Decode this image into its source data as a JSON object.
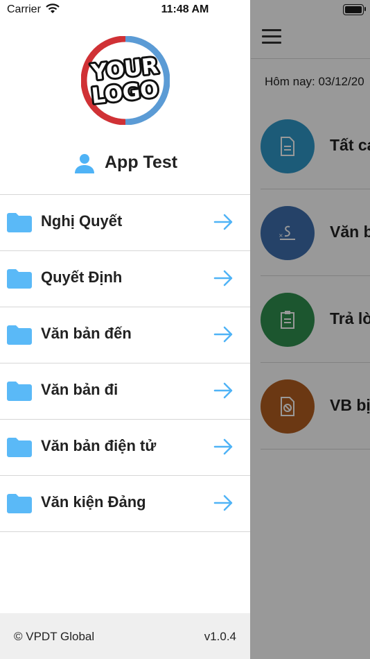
{
  "status_bar": {
    "carrier": "Carrier",
    "time": "11:48 AM"
  },
  "main": {
    "today": "Hôm nay: 03/12/20",
    "items": [
      {
        "label": "Tất ca",
        "color": "#2f98c9",
        "icon": "document-icon"
      },
      {
        "label": "Văn b",
        "color": "#3f6fae",
        "icon": "signature-icon"
      },
      {
        "label": "Trả lờ",
        "color": "#2f8f4f",
        "icon": "clipboard-icon"
      },
      {
        "label": "VB bị",
        "color": "#b25e21",
        "icon": "blocked-document-icon"
      }
    ]
  },
  "drawer": {
    "logo_text": "YOUR LOGO",
    "user_name": "App Test",
    "menu": [
      {
        "label": "Nghị Quyết"
      },
      {
        "label": "Quyết Định"
      },
      {
        "label": "Văn bản đến"
      },
      {
        "label": "Văn bản đi"
      },
      {
        "label": "Văn bản điện tử"
      },
      {
        "label": "Văn kiện Đảng"
      }
    ],
    "footer": {
      "copyright": "© VPDT Global",
      "version": "v1.0.4"
    }
  },
  "colors": {
    "accent": "#4fb3f6",
    "folder": "#5ab9f7",
    "logo_red": "#d03135",
    "logo_blue": "#5b9bd5"
  }
}
